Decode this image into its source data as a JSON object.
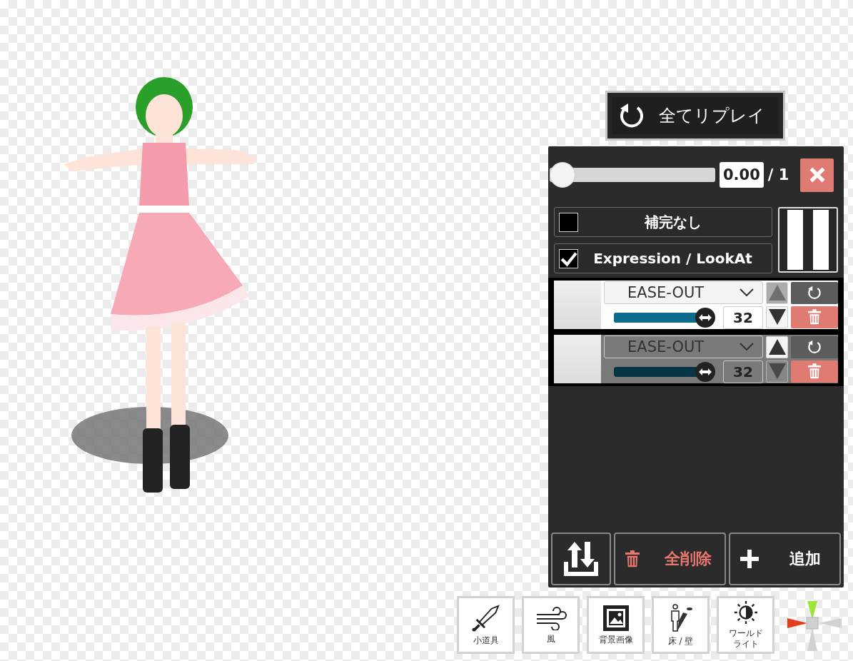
{
  "replay_all_button": {
    "label": "全てリプレイ"
  },
  "timeline": {
    "level": 0,
    "time": "0.00",
    "total": "/ 1"
  },
  "options": [
    {
      "label": "補完なし",
      "checked": false
    },
    {
      "label": "Expression / LookAt",
      "checked": true
    }
  ],
  "keyframes": [
    {
      "easing": "EASE-OUT",
      "level": 0.95,
      "frames": "32",
      "selected": true,
      "up_disabled": true,
      "down_disabled": false
    },
    {
      "easing": "EASE-OUT",
      "level": 0.95,
      "frames": "32",
      "selected": false,
      "up_disabled": false,
      "down_disabled": true
    }
  ],
  "actions": [
    {
      "kind": "sort"
    },
    {
      "kind": "delete_all",
      "label": "全削除"
    },
    {
      "kind": "add",
      "label": "追加"
    }
  ],
  "tools": [
    {
      "kind": "sword",
      "label": "小道具"
    },
    {
      "kind": "wind",
      "label": "風"
    },
    {
      "kind": "image",
      "label": "背景画像"
    },
    {
      "kind": "floor",
      "label": "床 / 壁"
    },
    {
      "kind": "light",
      "label": "ワールドライト"
    }
  ]
}
